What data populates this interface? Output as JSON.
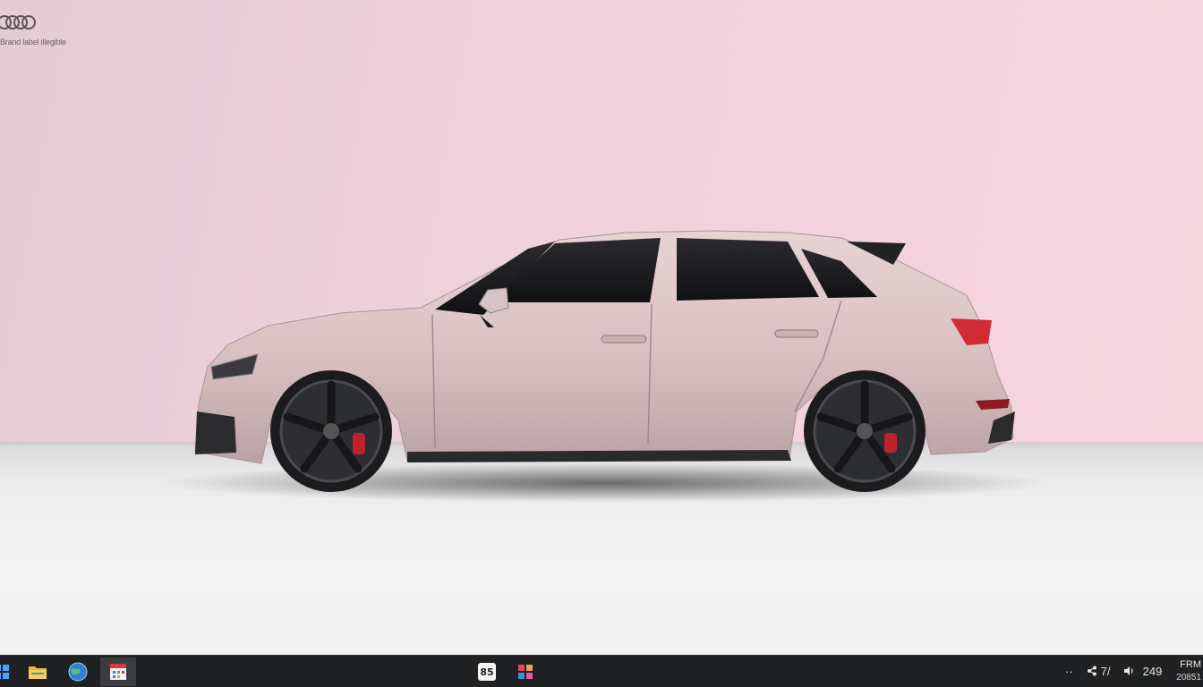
{
  "desktop": {
    "brand_text": "Brand label illegible",
    "wallpaper_subject": "pink-hatchback-side-view",
    "colors": {
      "wall": "#efd2dc",
      "floor": "#ececed",
      "car_body": "#d9c2c4",
      "glass": "#1e1d20",
      "wheel": "#2a2b2e",
      "brake_caliper": "#c0222b",
      "tail_light": "#d12b33"
    }
  },
  "taskbar": {
    "background": "#1f2123",
    "pinned": [
      {
        "name": "start-icon"
      },
      {
        "name": "file-explorer-icon"
      },
      {
        "name": "browser-globe-icon"
      },
      {
        "name": "calendar-app-icon"
      }
    ],
    "center_apps": [
      {
        "name": "app-tile-icon",
        "label": "85"
      },
      {
        "name": "colorful-grid-icon"
      }
    ],
    "tray": {
      "overflow": "··",
      "share_text": "7/",
      "volume_text": "249",
      "clock_time": "FRM",
      "clock_date": "20851"
    }
  }
}
